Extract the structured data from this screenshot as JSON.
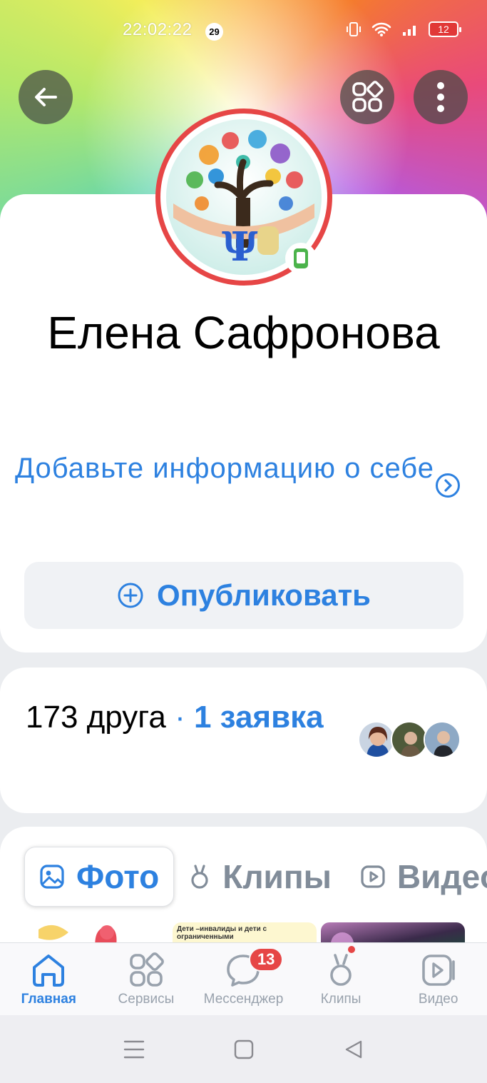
{
  "status_bar": {
    "time": "22:02:22",
    "notification_count": "29",
    "battery": "12"
  },
  "header": {
    "back_icon": "arrow-left-icon",
    "services_icon": "grid-apps-icon",
    "more_icon": "more-vertical-icon"
  },
  "profile": {
    "name": "Елена Сафронова",
    "about_link": "Добавьте информацию о себе",
    "publish_label": "Опубликовать",
    "online_indicator": "mobile-online-icon",
    "ring_color": "#e64646"
  },
  "friends": {
    "count_text": "173 друга",
    "separator": "·",
    "requests_text": "1 заявка"
  },
  "media_tabs": [
    {
      "label": "Фото",
      "icon": "photo-icon",
      "active": true
    },
    {
      "label": "Клипы",
      "icon": "clips-icon",
      "active": false
    },
    {
      "label": "Видео",
      "icon": "video-icon",
      "active": false
    }
  ],
  "media_preview": {
    "thumb2_caption": "Дети –инвалиды и дети с ограниченными"
  },
  "tabbar": [
    {
      "label": "Главная",
      "icon": "home-icon",
      "active": true
    },
    {
      "label": "Сервисы",
      "icon": "services-icon",
      "active": false
    },
    {
      "label": "Мессенджер",
      "icon": "messenger-icon",
      "badge": "13",
      "active": false
    },
    {
      "label": "Клипы",
      "icon": "clips-icon",
      "active": false
    },
    {
      "label": "Видео",
      "icon": "video-icon",
      "active": false
    }
  ],
  "system_nav": {
    "menu_icon": "menu-icon",
    "home_icon": "square-home-icon",
    "back_icon": "triangle-back-icon"
  },
  "colors": {
    "accent": "#2d81e0",
    "badge": "#e64646",
    "online": "#4bb34b"
  }
}
